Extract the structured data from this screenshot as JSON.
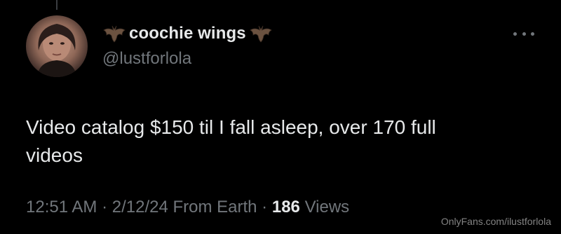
{
  "author": {
    "display_name": "coochie wings",
    "handle": "@lustforlola",
    "name_emoji_left": "bat-icon",
    "name_emoji_right": "bat-icon"
  },
  "tweet": {
    "text_line1": "Video catalog $150 til I fall asleep, over 170 full",
    "text_line2": "videos"
  },
  "meta": {
    "time": "12:51 AM",
    "separator": " · ",
    "date": "2/12/24",
    "source": "From Earth",
    "views_count": "186",
    "views_label": "Views"
  },
  "watermark": "OnlyFans.com/ilustforlola",
  "colors": {
    "background": "#000000",
    "primary_text": "#e7e9ea",
    "secondary_text": "#71767b"
  }
}
